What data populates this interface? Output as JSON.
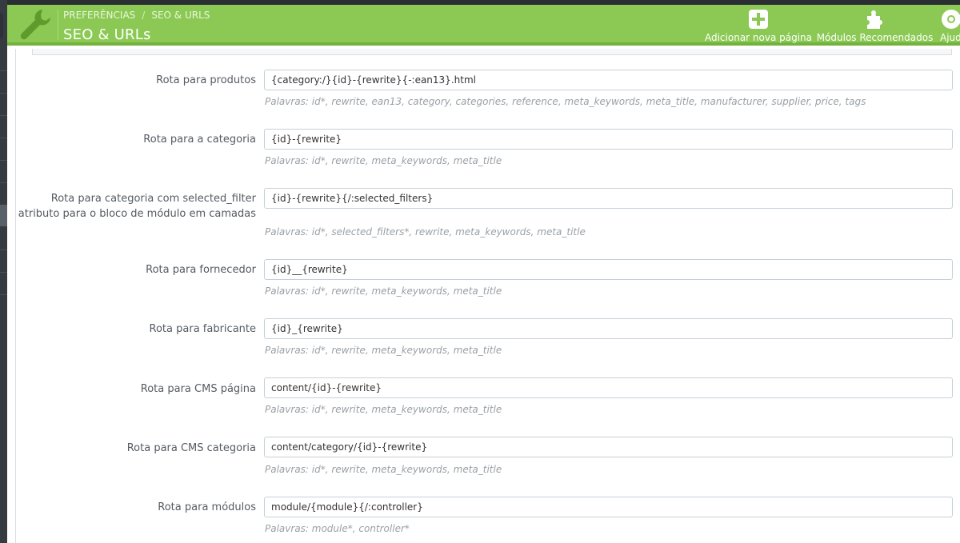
{
  "header": {
    "breadcrumb": [
      "PREFERÊNCIAS",
      "SEO & URLS"
    ],
    "breadcrumb_separator": "/",
    "title": "SEO & URLs",
    "toolbar": {
      "add_page": "Adicionar nova página",
      "recommended_modules": "Módulos Recomendados",
      "help": "Ajuda"
    },
    "icons": {
      "section": "wrench-icon",
      "add": "plus-square-icon",
      "modules": "puzzle-icon",
      "help": "lifebuoy-icon"
    }
  },
  "colors": {
    "header_green": "#8bc954",
    "sidebar_dark": "#363a41"
  },
  "routes": [
    {
      "label": "Rota para produtos",
      "value": "{category:/}{id}-{rewrite}{-:ean13}.html",
      "help": "Palavras: id*, rewrite, ean13, category, categories, reference, meta_keywords, meta_title, manufacturer, supplier, price, tags"
    },
    {
      "label": "Rota para a categoria",
      "value": "{id}-{rewrite}",
      "help": "Palavras: id*, rewrite, meta_keywords, meta_title"
    },
    {
      "label": "Rota para categoria com selected_filter",
      "label2": "atributo para o bloco de módulo em camadas",
      "value": "{id}-{rewrite}{/:selected_filters}",
      "help": "Palavras: id*, selected_filters*, rewrite, meta_keywords, meta_title"
    },
    {
      "label": "Rota para fornecedor",
      "value": "{id}__{rewrite}",
      "help": "Palavras: id*, rewrite, meta_keywords, meta_title"
    },
    {
      "label": "Rota para fabricante",
      "value": "{id}_{rewrite}",
      "help": "Palavras: id*, rewrite, meta_keywords, meta_title"
    },
    {
      "label": "Rota para CMS página",
      "value": "content/{id}-{rewrite}",
      "help": "Palavras: id*, rewrite, meta_keywords, meta_title"
    },
    {
      "label": "Rota para CMS categoria",
      "value": "content/category/{id}-{rewrite}",
      "help": "Palavras: id*, rewrite, meta_keywords, meta_title"
    },
    {
      "label": "Rota para módulos",
      "value": "module/{module}{/:controller}",
      "help": "Palavras: module*, controller*"
    }
  ]
}
